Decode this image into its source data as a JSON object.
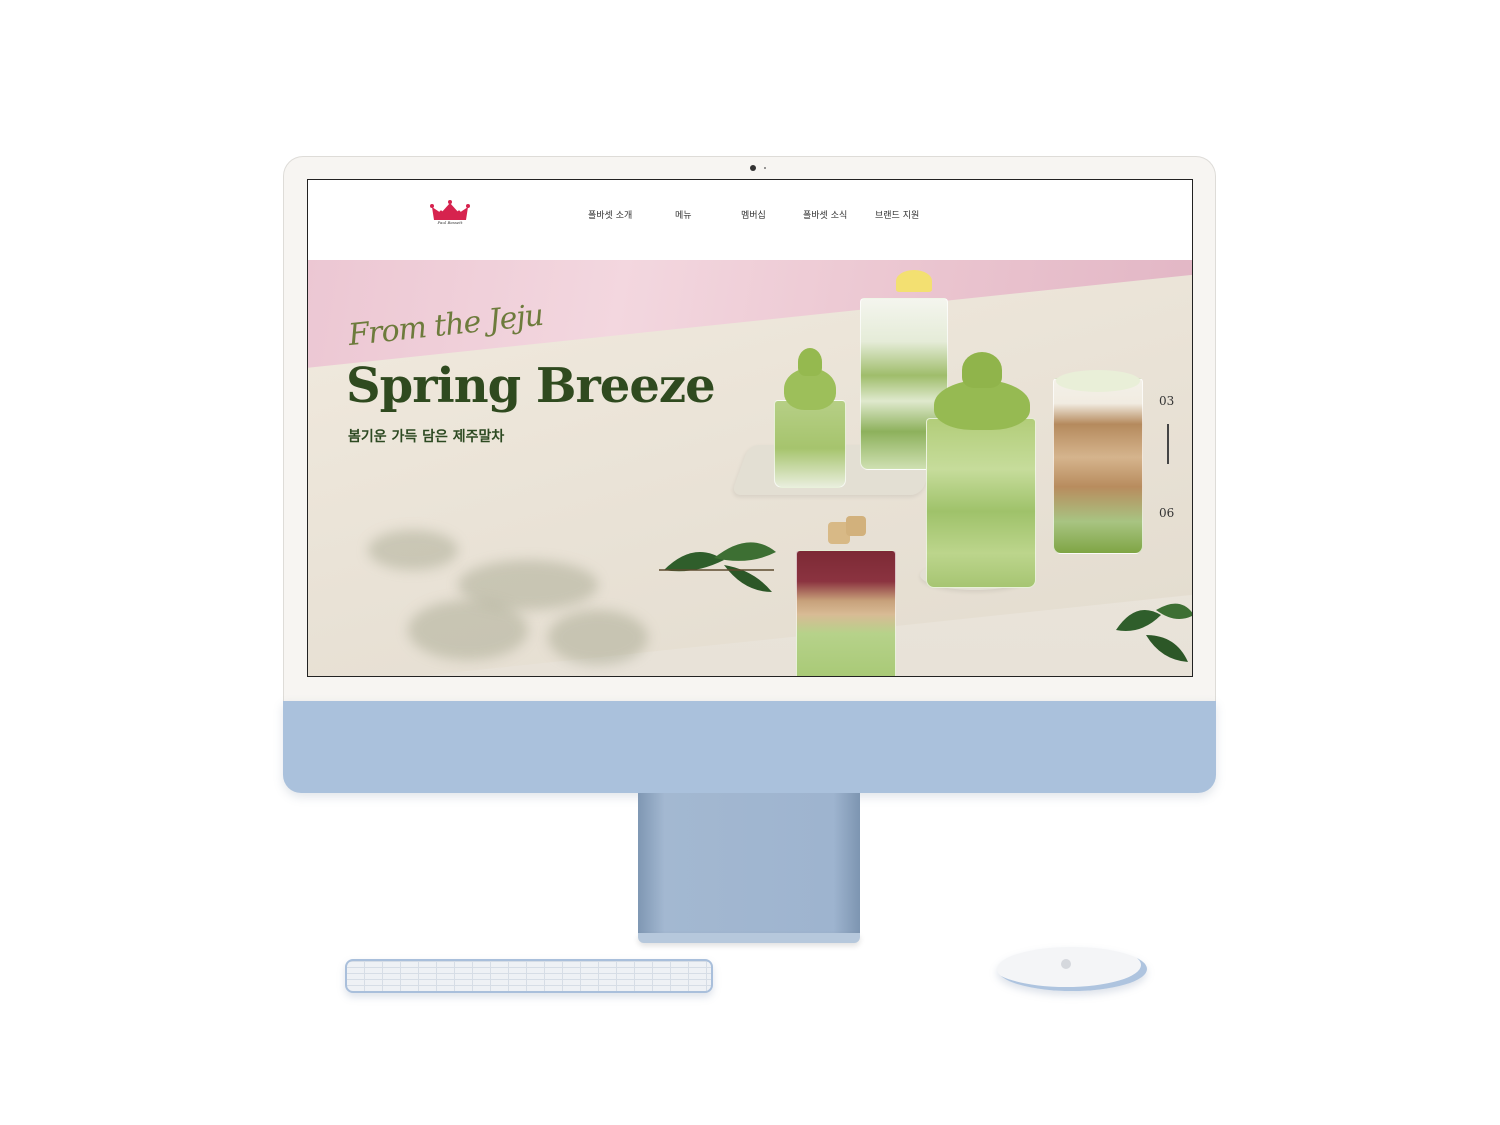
{
  "site": {
    "logo_text": "Paul Bassett",
    "nav": [
      {
        "label": "폴바셋 소개"
      },
      {
        "label": "메뉴"
      },
      {
        "label": "멤버십"
      },
      {
        "label": "폴바셋 소식"
      },
      {
        "label": "브랜드 지원"
      }
    ]
  },
  "hero": {
    "script": "From the Jeju",
    "headline": "Spring Breeze",
    "subtitle": "봄기운 가득 담은 제주말차",
    "pager": {
      "current": "03",
      "total": "06"
    }
  },
  "colors": {
    "headline": "#2f4a1f",
    "script": "#6d7b3c",
    "brand_crown": "#d6234e",
    "chin": "#aac1dc",
    "matcha": "#8fb457"
  },
  "icons": [
    "crown-logo-icon",
    "camera-icon",
    "apple-logo-icon"
  ]
}
